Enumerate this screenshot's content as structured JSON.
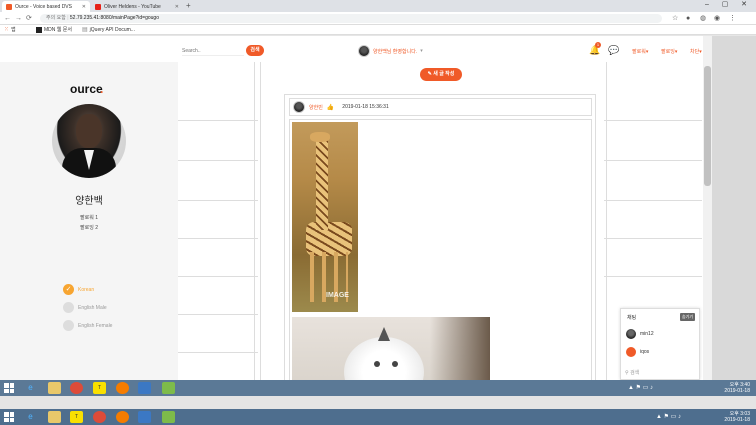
{
  "browser": {
    "tabs": [
      {
        "title": "Ource - Voice based DVS",
        "active": true
      },
      {
        "title": "Oliver Heldens - YouTube",
        "active": false
      }
    ],
    "address": {
      "security": "주의 요함",
      "url": "52.79.235.41:8080/mainPage?id=gougo"
    },
    "bookmarks": [
      {
        "label": "앱"
      },
      {
        "label": "MDN 웹 문서"
      },
      {
        "label": "jQuery API Docum..."
      }
    ]
  },
  "header": {
    "search_placeholder": "Search..",
    "search_button": "검색",
    "welcome": "양한백님 환영합니다.",
    "notification_count": "1",
    "menu": [
      "팔로워",
      "팔로잉",
      "차단"
    ]
  },
  "sidebar": {
    "logo": "ource",
    "logo_dot": ".",
    "username": "양한백",
    "followers": "팔로워 1",
    "following": "팔로잉 2",
    "voices": [
      {
        "label": "Korean",
        "selected": true
      },
      {
        "label": "English Male",
        "selected": false
      },
      {
        "label": "English Female",
        "selected": false
      }
    ]
  },
  "feed": {
    "new_post_button": "새 글 작성",
    "post": {
      "author": "양한빈",
      "date": "2019-01-18 15:36:31",
      "image_watermark": "IMAGE"
    }
  },
  "chat": {
    "title": "채팅",
    "close": "숨기기",
    "users": [
      "min12",
      "iqos"
    ],
    "search_placeholder": "검색"
  },
  "taskbar": {
    "top": {
      "time": "오후 3:40",
      "date": "2019-01-18"
    },
    "bottom": {
      "time": "오후 3:03",
      "date": "2019-01-18"
    }
  },
  "colors": {
    "accent": "#f05a28",
    "radio_selected": "#f7a531",
    "taskbar": "#5b7996"
  }
}
